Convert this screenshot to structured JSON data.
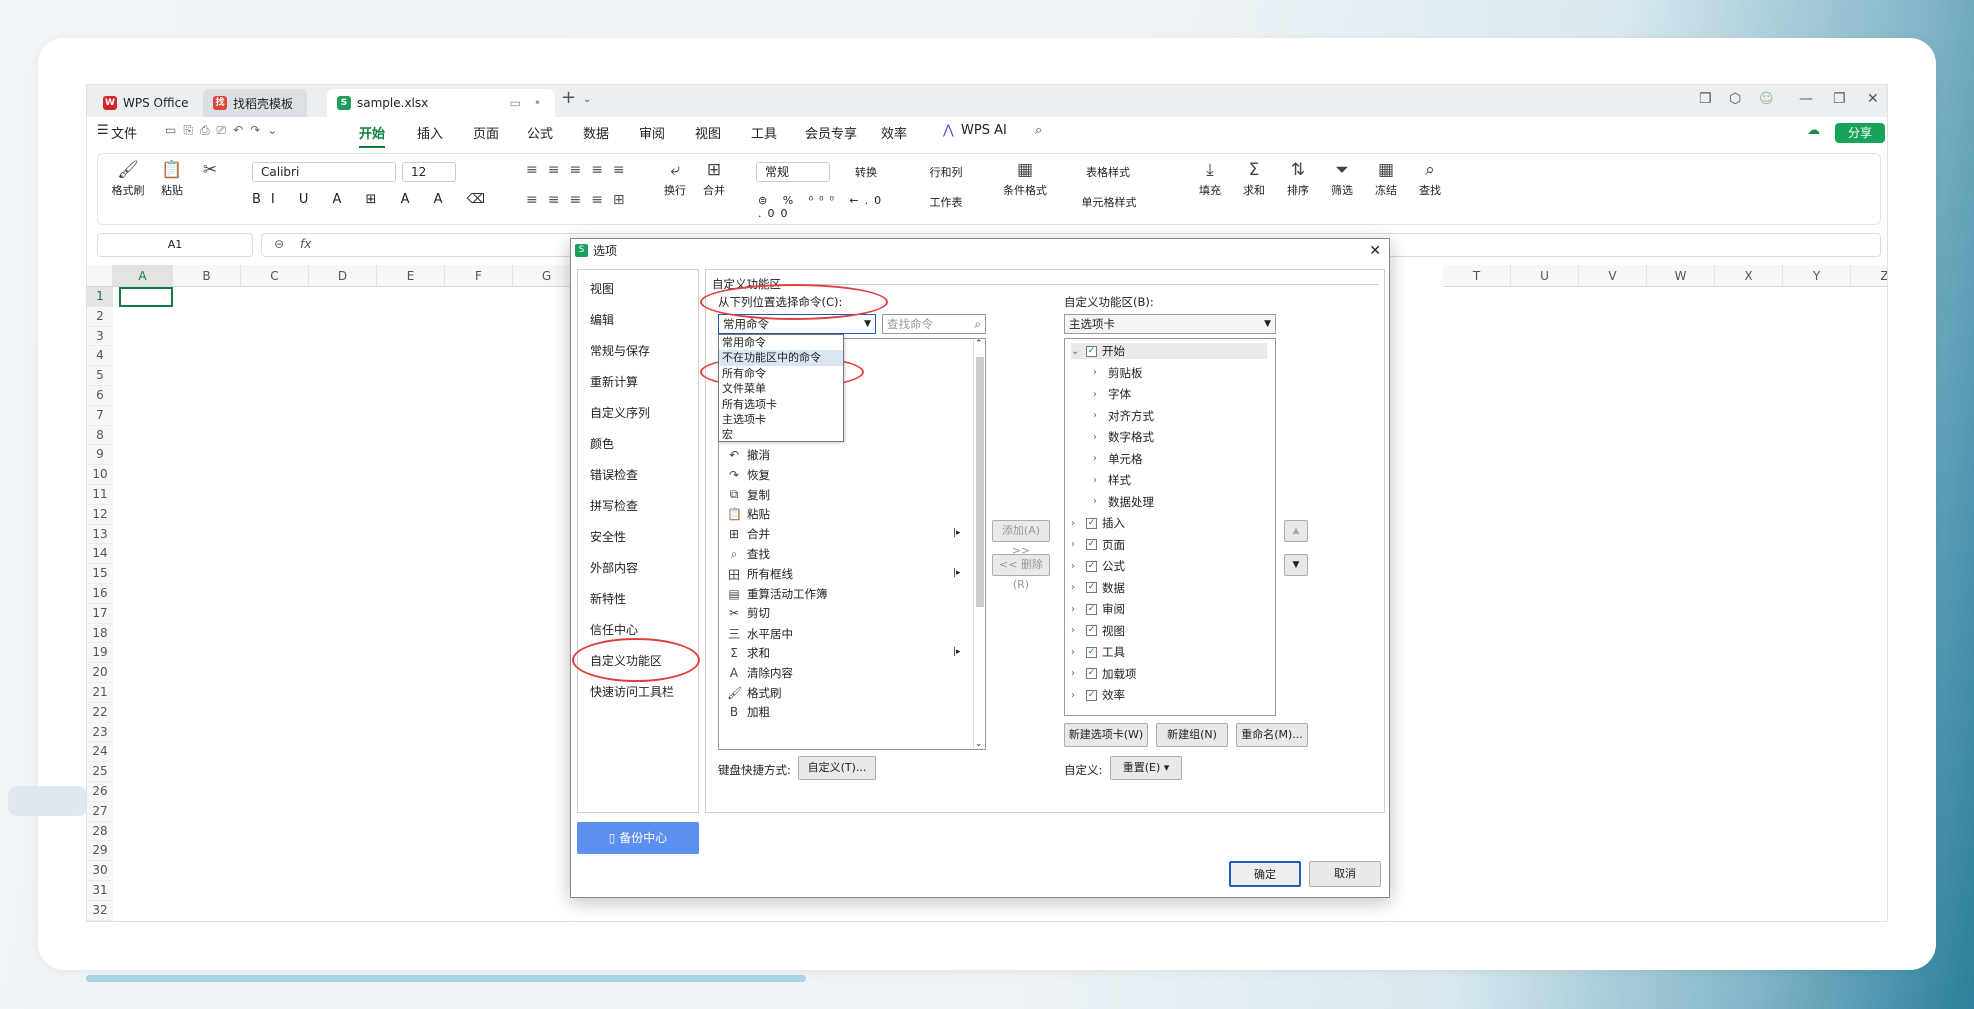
{
  "tabs": [
    {
      "label": "WPS Office"
    },
    {
      "label": "找稻壳模板"
    },
    {
      "label": "sample.xlsx"
    }
  ],
  "menu": {
    "file": "文件",
    "items": [
      "开始",
      "插入",
      "页面",
      "公式",
      "数据",
      "审阅",
      "视图",
      "工具",
      "会员专享",
      "效率"
    ],
    "ai": "WPS AI",
    "share": "分享"
  },
  "ribbon": {
    "format_painter": "格式刷",
    "paste": "粘贴",
    "font": "Calibri",
    "size": "12",
    "number_format": "常规",
    "convert": "转换",
    "row_col": "行和列",
    "worksheet": "工作表",
    "wrap": "换行",
    "merge": "合并",
    "cond_format": "条件格式",
    "table_style": "表格样式",
    "cell_style": "单元格样式",
    "fill": "填充",
    "sum": "求和",
    "sort": "排序",
    "filter": "筛选",
    "freeze": "冻结",
    "find": "查找"
  },
  "namebox": "A1",
  "fx": "fx",
  "columns": [
    "A",
    "B",
    "C",
    "D",
    "E",
    "F",
    "G",
    "T",
    "U",
    "V",
    "W",
    "X",
    "Y",
    "Z"
  ],
  "rows": [
    "1",
    "2",
    "3",
    "4",
    "5",
    "6",
    "7",
    "8",
    "9",
    "10",
    "11",
    "12",
    "13",
    "14",
    "15",
    "16",
    "17",
    "18",
    "19",
    "20",
    "21",
    "22",
    "23",
    "24",
    "25",
    "26",
    "27",
    "28",
    "29",
    "30",
    "31",
    "32"
  ],
  "dialog": {
    "title": "选项",
    "nav": [
      "视图",
      "编辑",
      "常规与保存",
      "重新计算",
      "自定义序列",
      "颜色",
      "错误检查",
      "拼写检查",
      "安全性",
      "外部内容",
      "新特性",
      "信任中心",
      "自定义功能区",
      "快速访问工具栏"
    ],
    "backup": "备份中心",
    "section": "自定义功能区",
    "choose_label": "从下列位置选择命令(C):",
    "choose_value": "常用命令",
    "search_placeholder": "查找命令",
    "dropdown_options": [
      "常用命令",
      "不在功能区中的命令",
      "所有命令",
      "文件菜单",
      "所有选项卡",
      "主选项卡",
      "宏"
    ],
    "commands": [
      {
        "icon": "↶",
        "label": "撤消"
      },
      {
        "icon": "↷",
        "label": "恢复"
      },
      {
        "icon": "⧉",
        "label": "复制"
      },
      {
        "icon": "📋",
        "label": "粘贴"
      },
      {
        "icon": "⊞",
        "label": "合并",
        "sub": true
      },
      {
        "icon": "⌕",
        "label": "查找"
      },
      {
        "icon": "田",
        "label": "所有框线",
        "sub": true
      },
      {
        "icon": "▤",
        "label": "重算活动工作簿"
      },
      {
        "icon": "✂",
        "label": "剪切"
      },
      {
        "icon": "三",
        "label": "水平居中"
      },
      {
        "icon": "Σ",
        "label": "求和",
        "sub": true
      },
      {
        "icon": "A",
        "label": "清除内容"
      },
      {
        "icon": "🖌",
        "label": "格式刷"
      },
      {
        "icon": "B",
        "label": "加粗"
      }
    ],
    "add": "添加(A) >>",
    "remove": "<< 删除(R)",
    "right_label": "自定义功能区(B):",
    "right_value": "主选项卡",
    "tree": [
      {
        "label": "开始",
        "level": 0,
        "open": true,
        "check": true
      },
      {
        "label": "剪贴板",
        "level": 1
      },
      {
        "label": "字体",
        "level": 1
      },
      {
        "label": "对齐方式",
        "level": 1
      },
      {
        "label": "数字格式",
        "level": 1
      },
      {
        "label": "单元格",
        "level": 1
      },
      {
        "label": "样式",
        "level": 1
      },
      {
        "label": "数据处理",
        "level": 1
      },
      {
        "label": "插入",
        "level": 0,
        "check": true
      },
      {
        "label": "页面",
        "level": 0,
        "check": true
      },
      {
        "label": "公式",
        "level": 0,
        "check": true
      },
      {
        "label": "数据",
        "level": 0,
        "check": true
      },
      {
        "label": "审阅",
        "level": 0,
        "check": true
      },
      {
        "label": "视图",
        "level": 0,
        "check": true
      },
      {
        "label": "工具",
        "level": 0,
        "check": true
      },
      {
        "label": "加载项",
        "level": 0,
        "check": true
      },
      {
        "label": "效率",
        "level": 0,
        "check": true
      }
    ],
    "new_tab": "新建选项卡(W)",
    "new_group": "新建组(N)",
    "rename": "重命名(M)...",
    "custom_label": "自定义:",
    "reset": "重置(E)",
    "keyboard_label": "键盘快捷方式:",
    "customize": "自定义(T)...",
    "ok": "确定",
    "cancel": "取消"
  }
}
